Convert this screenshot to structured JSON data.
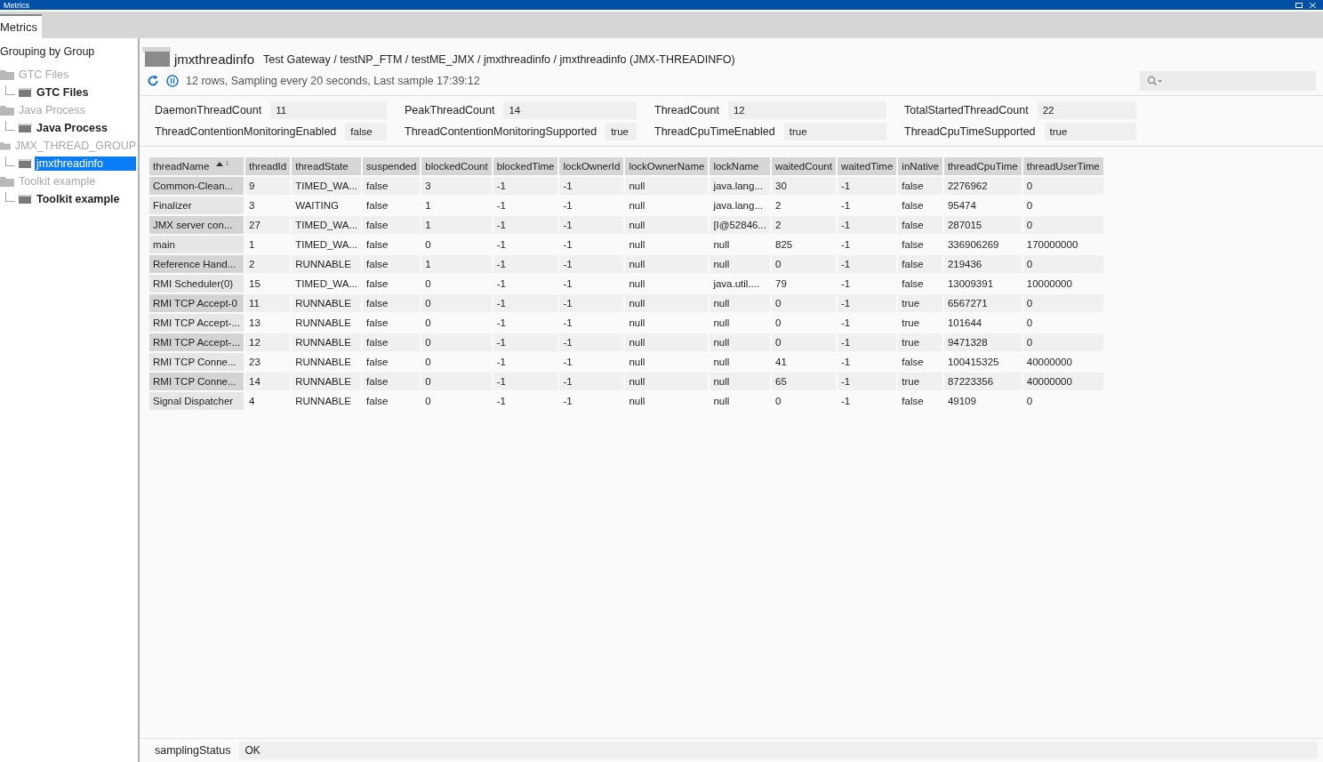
{
  "window": {
    "title": "Metrics"
  },
  "tabs": [
    {
      "label": "Metrics",
      "selected": true
    }
  ],
  "sidebar": {
    "heading": "Grouping by Group",
    "items": [
      {
        "label": "GTC Files",
        "kind": "group",
        "selected": false,
        "children": [
          {
            "label": "GTC Files",
            "kind": "leaf",
            "selected": false
          }
        ]
      },
      {
        "label": "Java Process",
        "kind": "group",
        "selected": false,
        "children": [
          {
            "label": "Java Process",
            "kind": "leaf",
            "selected": false
          }
        ]
      },
      {
        "label": "JMX_THREAD_GROUP",
        "kind": "group",
        "selected": false,
        "children": [
          {
            "label": "jmxthreadinfo",
            "kind": "leaf",
            "selected": true
          }
        ]
      },
      {
        "label": "Toolkit example",
        "kind": "group",
        "selected": false,
        "children": [
          {
            "label": "Toolkit example",
            "kind": "leaf",
            "selected": false
          }
        ]
      }
    ]
  },
  "header": {
    "name": "jmxthreadinfo",
    "path": "Test Gateway / testNP_FTM / testME_JMX / jmxthreadinfo / jmxthreadinfo (JMX-THREADINFO)",
    "status": "12 rows, Sampling every 20 seconds, Last sample 17:39:12"
  },
  "properties": [
    {
      "label": "DaemonThreadCount",
      "value": "11"
    },
    {
      "label": "PeakThreadCount",
      "value": "14"
    },
    {
      "label": "ThreadCount",
      "value": "12"
    },
    {
      "label": "TotalStartedThreadCount",
      "value": "22"
    },
    {
      "label": "ThreadContentionMonitoringEnabled",
      "value": "false"
    },
    {
      "label": "ThreadContentionMonitoringSupported",
      "value": "true"
    },
    {
      "label": "ThreadCpuTimeEnabled",
      "value": "true"
    },
    {
      "label": "ThreadCpuTimeSupported",
      "value": "true"
    }
  ],
  "table": {
    "columns": [
      {
        "label": "threadName",
        "sort_order": "1"
      },
      {
        "label": "threadId"
      },
      {
        "label": "threadState"
      },
      {
        "label": "suspended"
      },
      {
        "label": "blockedCount"
      },
      {
        "label": "blockedTime"
      },
      {
        "label": "lockOwnerId"
      },
      {
        "label": "lockOwnerName"
      },
      {
        "label": "lockName"
      },
      {
        "label": "waitedCount"
      },
      {
        "label": "waitedTime"
      },
      {
        "label": "inNative"
      },
      {
        "label": "threadCpuTime"
      },
      {
        "label": "threadUserTime"
      }
    ],
    "rows": [
      [
        "Common-Clean...",
        "9",
        "TIMED_WA...",
        "false",
        "3",
        "-1",
        "-1",
        "null",
        "java.lang...",
        "30",
        "-1",
        "false",
        "2276962",
        "0"
      ],
      [
        "Finalizer",
        "3",
        "WAITING",
        "false",
        "1",
        "-1",
        "-1",
        "null",
        "java.lang...",
        "2",
        "-1",
        "false",
        "95474",
        "0"
      ],
      [
        "JMX server con...",
        "27",
        "TIMED_WA...",
        "false",
        "1",
        "-1",
        "-1",
        "null",
        "[I@52846...",
        "2",
        "-1",
        "false",
        "287015",
        "0"
      ],
      [
        "main",
        "1",
        "TIMED_WA...",
        "false",
        "0",
        "-1",
        "-1",
        "null",
        "null",
        "825",
        "-1",
        "false",
        "336906269",
        "170000000"
      ],
      [
        "Reference Hand...",
        "2",
        "RUNNABLE",
        "false",
        "1",
        "-1",
        "-1",
        "null",
        "null",
        "0",
        "-1",
        "false",
        "219436",
        "0"
      ],
      [
        "RMI Scheduler(0)",
        "15",
        "TIMED_WA...",
        "false",
        "0",
        "-1",
        "-1",
        "null",
        "java.util....",
        "79",
        "-1",
        "false",
        "13009391",
        "10000000"
      ],
      [
        "RMI TCP Accept-0",
        "11",
        "RUNNABLE",
        "false",
        "0",
        "-1",
        "-1",
        "null",
        "null",
        "0",
        "-1",
        "true",
        "6567271",
        "0"
      ],
      [
        "RMI TCP Accept-...",
        "13",
        "RUNNABLE",
        "false",
        "0",
        "-1",
        "-1",
        "null",
        "null",
        "0",
        "-1",
        "true",
        "101644",
        "0"
      ],
      [
        "RMI TCP Accept-...",
        "12",
        "RUNNABLE",
        "false",
        "0",
        "-1",
        "-1",
        "null",
        "null",
        "0",
        "-1",
        "true",
        "9471328",
        "0"
      ],
      [
        "RMI TCP Conne...",
        "23",
        "RUNNABLE",
        "false",
        "0",
        "-1",
        "-1",
        "null",
        "null",
        "41",
        "-1",
        "false",
        "100415325",
        "40000000"
      ],
      [
        "RMI TCP Conne...",
        "14",
        "RUNNABLE",
        "false",
        "0",
        "-1",
        "-1",
        "null",
        "null",
        "65",
        "-1",
        "true",
        "87223356",
        "40000000"
      ],
      [
        "Signal Dispatcher",
        "4",
        "RUNNABLE",
        "false",
        "0",
        "-1",
        "-1",
        "null",
        "null",
        "0",
        "-1",
        "false",
        "49109",
        "0"
      ]
    ]
  },
  "status_bar": {
    "label": "samplingStatus",
    "value": "OK"
  }
}
